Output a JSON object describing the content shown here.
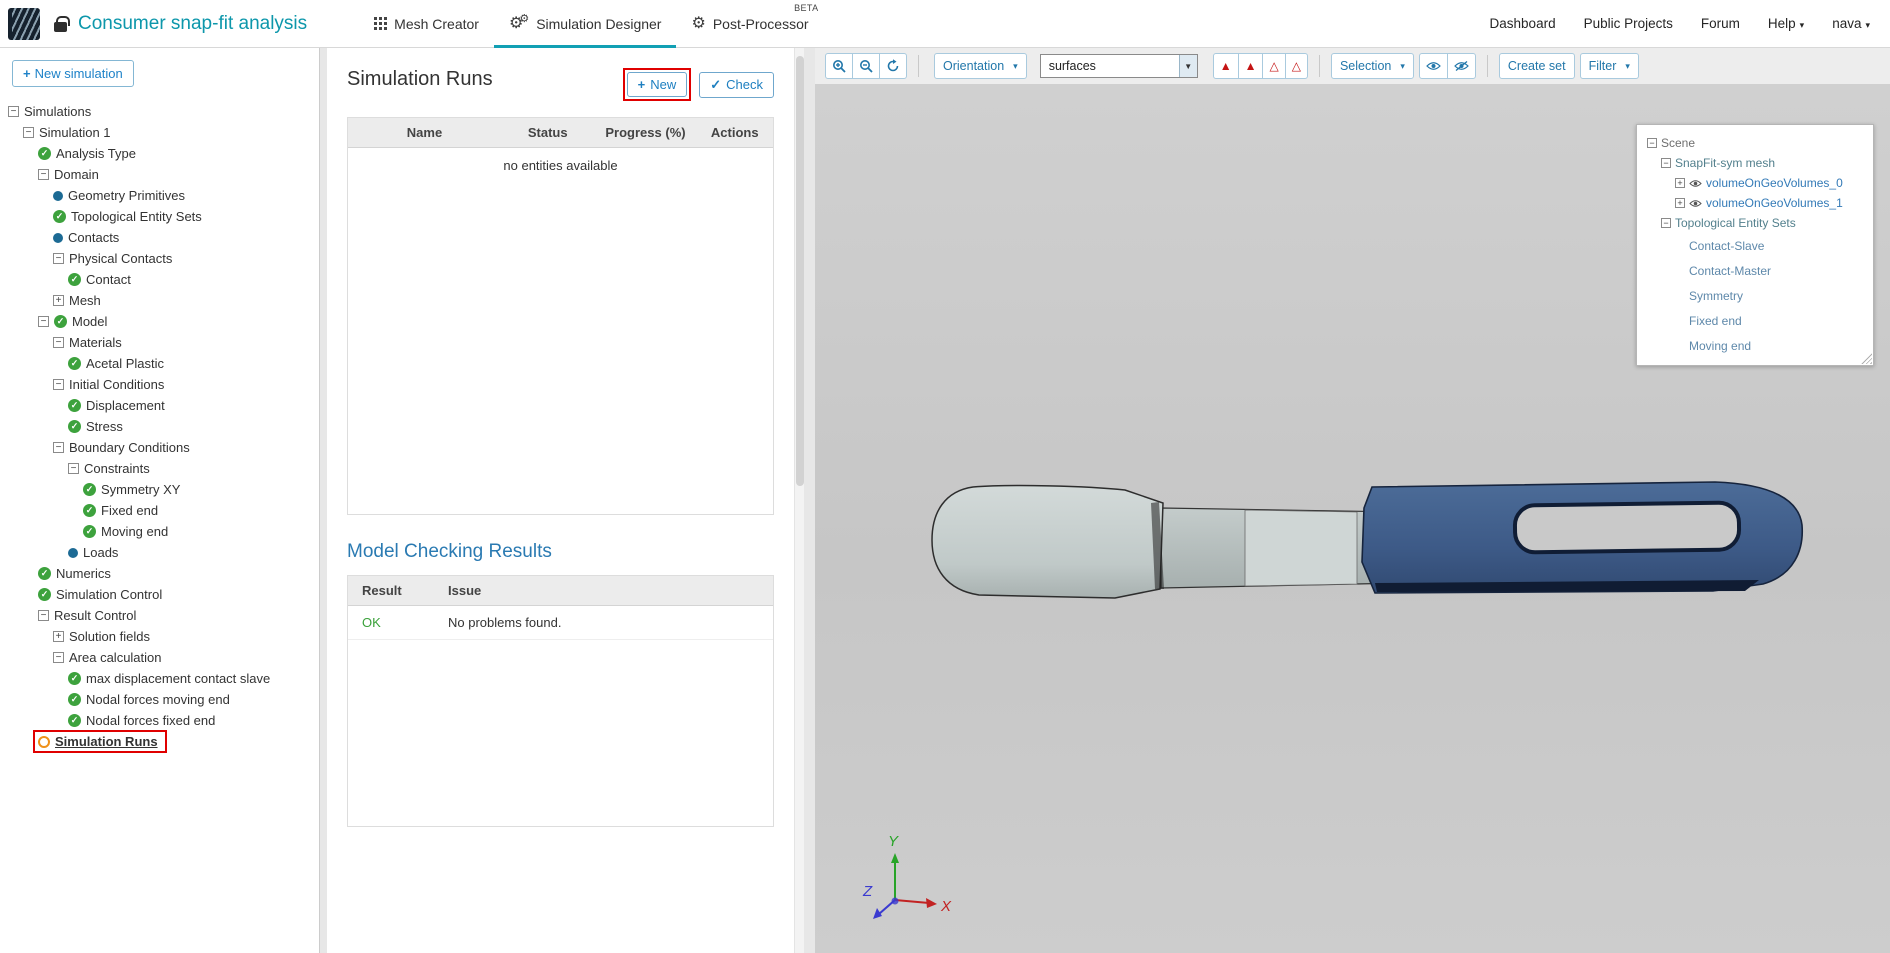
{
  "colors": {
    "brand_teal": "#0d97ab",
    "active_tab_underline": "#12a0b4",
    "link_blue": "#337ab7",
    "button_blue": "#1e7fc0",
    "check_green": "#3da23d",
    "status_dot_blue": "#1c6a94",
    "pending_orange": "#ef9119",
    "annotation_red": "#e00000",
    "ok_green": "#3aa13a",
    "model_gray": "#c0c9c8",
    "model_blue": "#3d5a87",
    "viewport_background": "#c9c9c9"
  },
  "header": {
    "project_title": "Consumer snap-fit analysis",
    "tabs": [
      {
        "label": "Mesh Creator",
        "active": false
      },
      {
        "label": "Simulation Designer",
        "active": true
      },
      {
        "label": "Post-Processor",
        "active": false,
        "badge": "BETA"
      }
    ],
    "links": [
      "Dashboard",
      "Public Projects",
      "Forum"
    ],
    "help": "Help",
    "user": "nava"
  },
  "sidebar": {
    "new_simulation": "New simulation",
    "tree": [
      {
        "label": "Simulations",
        "depth": 0,
        "icons": [
          "collapse"
        ]
      },
      {
        "label": "Simulation 1",
        "depth": 1,
        "icons": [
          "collapse"
        ]
      },
      {
        "label": "Analysis Type",
        "depth": 2,
        "icons": [
          "check"
        ]
      },
      {
        "label": "Domain",
        "depth": 2,
        "icons": [
          "collapse"
        ]
      },
      {
        "label": "Geometry Primitives",
        "depth": 3,
        "icons": [
          "dot"
        ]
      },
      {
        "label": "Topological Entity Sets",
        "depth": 3,
        "icons": [
          "check"
        ]
      },
      {
        "label": "Contacts",
        "depth": 3,
        "icons": [
          "dot"
        ]
      },
      {
        "label": "Physical Contacts",
        "depth": 3,
        "icons": [
          "collapse"
        ]
      },
      {
        "label": "Contact",
        "depth": 4,
        "icons": [
          "check"
        ]
      },
      {
        "label": "Mesh",
        "depth": 3,
        "icons": [
          "expand"
        ]
      },
      {
        "label": "Model",
        "depth": 2,
        "icons": [
          "collapse",
          "check"
        ]
      },
      {
        "label": "Materials",
        "depth": 3,
        "icons": [
          "collapse"
        ]
      },
      {
        "label": "Acetal Plastic",
        "depth": 4,
        "icons": [
          "check"
        ]
      },
      {
        "label": "Initial Conditions",
        "depth": 3,
        "icons": [
          "collapse"
        ]
      },
      {
        "label": "Displacement",
        "depth": 4,
        "icons": [
          "check"
        ]
      },
      {
        "label": "Stress",
        "depth": 4,
        "icons": [
          "check"
        ]
      },
      {
        "label": "Boundary Conditions",
        "depth": 3,
        "icons": [
          "collapse"
        ]
      },
      {
        "label": "Constraints",
        "depth": 4,
        "icons": [
          "collapse"
        ]
      },
      {
        "label": "Symmetry XY",
        "depth": 5,
        "icons": [
          "check"
        ]
      },
      {
        "label": "Fixed end",
        "depth": 5,
        "icons": [
          "check"
        ]
      },
      {
        "label": "Moving end",
        "depth": 5,
        "icons": [
          "check"
        ]
      },
      {
        "label": "Loads",
        "depth": 4,
        "icons": [
          "dot"
        ]
      },
      {
        "label": "Numerics",
        "depth": 2,
        "icons": [
          "check"
        ]
      },
      {
        "label": "Simulation Control",
        "depth": 2,
        "icons": [
          "check"
        ]
      },
      {
        "label": "Result Control",
        "depth": 2,
        "icons": [
          "collapse"
        ]
      },
      {
        "label": "Solution fields",
        "depth": 3,
        "icons": [
          "expand"
        ]
      },
      {
        "label": "Area calculation",
        "depth": 3,
        "icons": [
          "collapse"
        ]
      },
      {
        "label": "max displacement contact slave",
        "depth": 4,
        "icons": [
          "check"
        ]
      },
      {
        "label": "Nodal forces moving end",
        "depth": 4,
        "icons": [
          "check"
        ]
      },
      {
        "label": "Nodal forces fixed end",
        "depth": 4,
        "icons": [
          "check"
        ]
      },
      {
        "label": "Simulation Runs",
        "depth": 2,
        "icons": [
          "runs"
        ],
        "annotated": true
      }
    ]
  },
  "runs_panel": {
    "title": "Simulation Runs",
    "new_label": "New",
    "check_label": "Check",
    "runs_table_headers": [
      "Name",
      "Status",
      "Progress (%)",
      "Actions"
    ],
    "empty_message": "no entities available",
    "model_checking": {
      "title": "Model Checking Results",
      "headers": [
        "Result",
        "Issue"
      ],
      "rows": [
        {
          "result": "OK",
          "issue": "No problems found."
        }
      ]
    }
  },
  "viewport": {
    "toolbar": {
      "orientation": "Orientation",
      "display_mode": "surfaces",
      "selection": "Selection",
      "create_set": "Create set",
      "filter": "Filter"
    },
    "scene_tree": [
      {
        "label": "Scene",
        "depth": 0,
        "icons": [
          "collapse"
        ],
        "tone": "plain"
      },
      {
        "label": "SnapFit-sym mesh",
        "depth": 1,
        "icons": [
          "collapse"
        ],
        "tone": "teal"
      },
      {
        "label": "volumeOnGeoVolumes_0",
        "depth": 2,
        "icons": [
          "expand",
          "eye"
        ],
        "tone": "link"
      },
      {
        "label": "volumeOnGeoVolumes_1",
        "depth": 2,
        "icons": [
          "expand",
          "eye"
        ],
        "tone": "link"
      },
      {
        "label": "Topological Entity Sets",
        "depth": 1,
        "icons": [
          "collapse"
        ],
        "tone": "teal"
      },
      {
        "label": "Contact-Slave",
        "depth": 3,
        "icons": [],
        "tone": "child"
      },
      {
        "label": "Contact-Master",
        "depth": 3,
        "icons": [],
        "tone": "child"
      },
      {
        "label": "Symmetry",
        "depth": 3,
        "icons": [],
        "tone": "child"
      },
      {
        "label": "Fixed end",
        "depth": 3,
        "icons": [],
        "tone": "child"
      },
      {
        "label": "Moving end",
        "depth": 3,
        "icons": [],
        "tone": "child"
      }
    ],
    "axes": {
      "x": "X",
      "y": "Y",
      "z": "Z"
    }
  }
}
